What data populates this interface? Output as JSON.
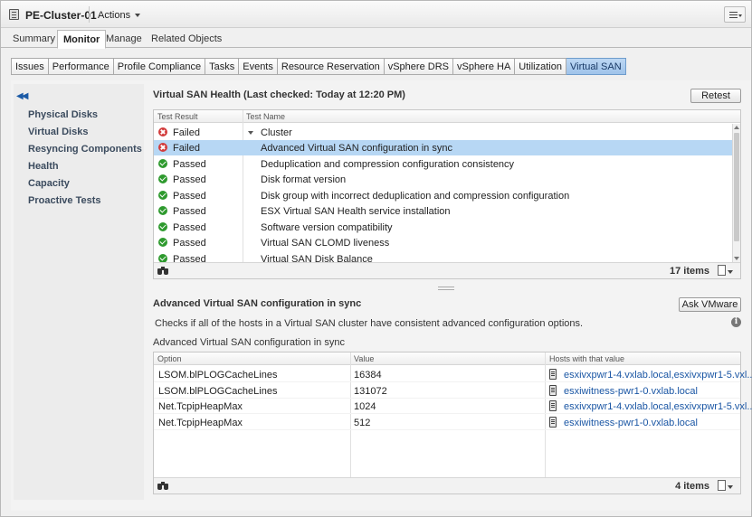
{
  "header": {
    "title": "PE-Cluster-01",
    "actions_label": "Actions"
  },
  "main_tabs": [
    "Summary",
    "Monitor",
    "Manage",
    "Related Objects"
  ],
  "active_main_tab": "Monitor",
  "sub_tabs": [
    "Issues",
    "Performance",
    "Profile Compliance",
    "Tasks",
    "Events",
    "Resource Reservation",
    "vSphere DRS",
    "vSphere HA",
    "Utilization",
    "Virtual SAN"
  ],
  "active_sub_tab": "Virtual SAN",
  "left_nav": [
    "Physical Disks",
    "Virtual Disks",
    "Resyncing Components",
    "Health",
    "Capacity",
    "Proactive Tests"
  ],
  "health": {
    "title": "Virtual SAN Health (Last checked: Today at 12:20 PM)",
    "retest_label": "Retest",
    "columns": [
      "Test Result",
      "Test Name"
    ],
    "rows": [
      {
        "result": "Failed",
        "status": "fail",
        "name": "Cluster",
        "group": true
      },
      {
        "result": "Failed",
        "status": "fail",
        "name": "Advanced Virtual SAN configuration in sync",
        "selected": true
      },
      {
        "result": "Passed",
        "status": "pass",
        "name": "Deduplication and compression configuration consistency"
      },
      {
        "result": "Passed",
        "status": "pass",
        "name": "Disk format version"
      },
      {
        "result": "Passed",
        "status": "pass",
        "name": "Disk group with incorrect deduplication and compression configuration"
      },
      {
        "result": "Passed",
        "status": "pass",
        "name": "ESX Virtual SAN Health service installation"
      },
      {
        "result": "Passed",
        "status": "pass",
        "name": "Software version compatibility"
      },
      {
        "result": "Passed",
        "status": "pass",
        "name": "Virtual SAN CLOMD liveness"
      },
      {
        "result": "Passed",
        "status": "pass",
        "name": "Virtual SAN Disk Balance"
      }
    ],
    "item_count": "17 items"
  },
  "detail": {
    "title": "Advanced Virtual SAN configuration in sync",
    "ask_vmware_label": "Ask VMware",
    "description": "Checks if all of the hosts in a Virtual SAN cluster have consistent advanced configuration options.",
    "subtitle": "Advanced Virtual SAN configuration in sync",
    "columns": [
      "Option",
      "Value",
      "Hosts with that value"
    ],
    "rows": [
      {
        "option": "LSOM.blPLOGCacheLines",
        "value": "16384",
        "hosts": "esxivxpwr1-4.vxlab.local,esxivxpwr1-5.vxl..."
      },
      {
        "option": "LSOM.blPLOGCacheLines",
        "value": "131072",
        "hosts": "esxiwitness-pwr1-0.vxlab.local"
      },
      {
        "option": "Net.TcpipHeapMax",
        "value": "1024",
        "hosts": "esxivxpwr1-4.vxlab.local,esxivxpwr1-5.vxl..."
      },
      {
        "option": "Net.TcpipHeapMax",
        "value": "512",
        "hosts": "esxiwitness-pwr1-0.vxlab.local"
      }
    ],
    "item_count": "4 items"
  }
}
